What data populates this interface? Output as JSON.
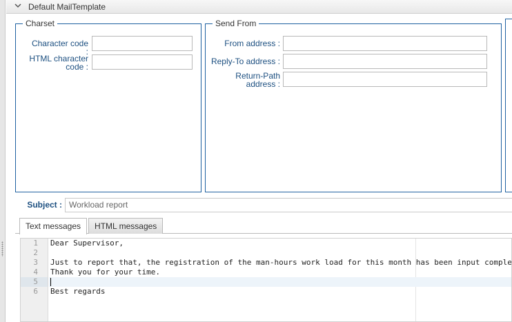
{
  "section": {
    "title": "Default MailTemplate"
  },
  "charset": {
    "legend": "Charset",
    "character_code_label": "Character code :",
    "character_code_value": "",
    "html_character_code_label_1": "HTML character",
    "html_character_code_label_2": "code :",
    "html_character_code_value": ""
  },
  "send_from": {
    "legend": "Send From",
    "from_label": "From address :",
    "from_value": "",
    "reply_to_label": "Reply-To address :",
    "reply_to_value": "",
    "return_path_label_1": "Return-Path",
    "return_path_label_2": "address :",
    "return_path_value": ""
  },
  "subject": {
    "label": "Subject :",
    "value": "Workload report"
  },
  "tabs": [
    {
      "label": "Text messages",
      "active": true
    },
    {
      "label": "HTML messages",
      "active": false
    }
  ],
  "editor": {
    "line_numbers": [
      "1",
      "2",
      "3",
      "4",
      "5",
      "6"
    ],
    "active_line": 5,
    "lines": [
      "Dear Supervisor,",
      "",
      "Just to report that, the registration of the man-hours work load for this month has been input comple",
      "Thank you for your time.",
      "",
      "Best regards"
    ]
  },
  "icons": {
    "collapse": "chevron-down-icon",
    "splitter": "drag-handle-icon"
  },
  "colors": {
    "label_blue": "#1c4f80",
    "fieldset_border": "#1c5fa0"
  }
}
